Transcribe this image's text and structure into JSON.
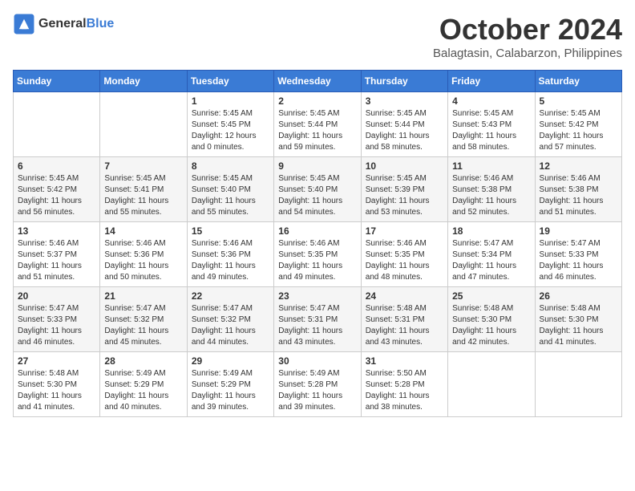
{
  "logo": {
    "general": "General",
    "blue": "Blue"
  },
  "title": "October 2024",
  "location": "Balagtasin, Calabarzon, Philippines",
  "headers": [
    "Sunday",
    "Monday",
    "Tuesday",
    "Wednesday",
    "Thursday",
    "Friday",
    "Saturday"
  ],
  "weeks": [
    [
      {
        "day": "",
        "sunrise": "",
        "sunset": "",
        "daylight": ""
      },
      {
        "day": "",
        "sunrise": "",
        "sunset": "",
        "daylight": ""
      },
      {
        "day": "1",
        "sunrise": "Sunrise: 5:45 AM",
        "sunset": "Sunset: 5:45 PM",
        "daylight": "Daylight: 12 hours and 0 minutes."
      },
      {
        "day": "2",
        "sunrise": "Sunrise: 5:45 AM",
        "sunset": "Sunset: 5:44 PM",
        "daylight": "Daylight: 11 hours and 59 minutes."
      },
      {
        "day": "3",
        "sunrise": "Sunrise: 5:45 AM",
        "sunset": "Sunset: 5:44 PM",
        "daylight": "Daylight: 11 hours and 58 minutes."
      },
      {
        "day": "4",
        "sunrise": "Sunrise: 5:45 AM",
        "sunset": "Sunset: 5:43 PM",
        "daylight": "Daylight: 11 hours and 58 minutes."
      },
      {
        "day": "5",
        "sunrise": "Sunrise: 5:45 AM",
        "sunset": "Sunset: 5:42 PM",
        "daylight": "Daylight: 11 hours and 57 minutes."
      }
    ],
    [
      {
        "day": "6",
        "sunrise": "Sunrise: 5:45 AM",
        "sunset": "Sunset: 5:42 PM",
        "daylight": "Daylight: 11 hours and 56 minutes."
      },
      {
        "day": "7",
        "sunrise": "Sunrise: 5:45 AM",
        "sunset": "Sunset: 5:41 PM",
        "daylight": "Daylight: 11 hours and 55 minutes."
      },
      {
        "day": "8",
        "sunrise": "Sunrise: 5:45 AM",
        "sunset": "Sunset: 5:40 PM",
        "daylight": "Daylight: 11 hours and 55 minutes."
      },
      {
        "day": "9",
        "sunrise": "Sunrise: 5:45 AM",
        "sunset": "Sunset: 5:40 PM",
        "daylight": "Daylight: 11 hours and 54 minutes."
      },
      {
        "day": "10",
        "sunrise": "Sunrise: 5:45 AM",
        "sunset": "Sunset: 5:39 PM",
        "daylight": "Daylight: 11 hours and 53 minutes."
      },
      {
        "day": "11",
        "sunrise": "Sunrise: 5:46 AM",
        "sunset": "Sunset: 5:38 PM",
        "daylight": "Daylight: 11 hours and 52 minutes."
      },
      {
        "day": "12",
        "sunrise": "Sunrise: 5:46 AM",
        "sunset": "Sunset: 5:38 PM",
        "daylight": "Daylight: 11 hours and 51 minutes."
      }
    ],
    [
      {
        "day": "13",
        "sunrise": "Sunrise: 5:46 AM",
        "sunset": "Sunset: 5:37 PM",
        "daylight": "Daylight: 11 hours and 51 minutes."
      },
      {
        "day": "14",
        "sunrise": "Sunrise: 5:46 AM",
        "sunset": "Sunset: 5:36 PM",
        "daylight": "Daylight: 11 hours and 50 minutes."
      },
      {
        "day": "15",
        "sunrise": "Sunrise: 5:46 AM",
        "sunset": "Sunset: 5:36 PM",
        "daylight": "Daylight: 11 hours and 49 minutes."
      },
      {
        "day": "16",
        "sunrise": "Sunrise: 5:46 AM",
        "sunset": "Sunset: 5:35 PM",
        "daylight": "Daylight: 11 hours and 49 minutes."
      },
      {
        "day": "17",
        "sunrise": "Sunrise: 5:46 AM",
        "sunset": "Sunset: 5:35 PM",
        "daylight": "Daylight: 11 hours and 48 minutes."
      },
      {
        "day": "18",
        "sunrise": "Sunrise: 5:47 AM",
        "sunset": "Sunset: 5:34 PM",
        "daylight": "Daylight: 11 hours and 47 minutes."
      },
      {
        "day": "19",
        "sunrise": "Sunrise: 5:47 AM",
        "sunset": "Sunset: 5:33 PM",
        "daylight": "Daylight: 11 hours and 46 minutes."
      }
    ],
    [
      {
        "day": "20",
        "sunrise": "Sunrise: 5:47 AM",
        "sunset": "Sunset: 5:33 PM",
        "daylight": "Daylight: 11 hours and 46 minutes."
      },
      {
        "day": "21",
        "sunrise": "Sunrise: 5:47 AM",
        "sunset": "Sunset: 5:32 PM",
        "daylight": "Daylight: 11 hours and 45 minutes."
      },
      {
        "day": "22",
        "sunrise": "Sunrise: 5:47 AM",
        "sunset": "Sunset: 5:32 PM",
        "daylight": "Daylight: 11 hours and 44 minutes."
      },
      {
        "day": "23",
        "sunrise": "Sunrise: 5:47 AM",
        "sunset": "Sunset: 5:31 PM",
        "daylight": "Daylight: 11 hours and 43 minutes."
      },
      {
        "day": "24",
        "sunrise": "Sunrise: 5:48 AM",
        "sunset": "Sunset: 5:31 PM",
        "daylight": "Daylight: 11 hours and 43 minutes."
      },
      {
        "day": "25",
        "sunrise": "Sunrise: 5:48 AM",
        "sunset": "Sunset: 5:30 PM",
        "daylight": "Daylight: 11 hours and 42 minutes."
      },
      {
        "day": "26",
        "sunrise": "Sunrise: 5:48 AM",
        "sunset": "Sunset: 5:30 PM",
        "daylight": "Daylight: 11 hours and 41 minutes."
      }
    ],
    [
      {
        "day": "27",
        "sunrise": "Sunrise: 5:48 AM",
        "sunset": "Sunset: 5:30 PM",
        "daylight": "Daylight: 11 hours and 41 minutes."
      },
      {
        "day": "28",
        "sunrise": "Sunrise: 5:49 AM",
        "sunset": "Sunset: 5:29 PM",
        "daylight": "Daylight: 11 hours and 40 minutes."
      },
      {
        "day": "29",
        "sunrise": "Sunrise: 5:49 AM",
        "sunset": "Sunset: 5:29 PM",
        "daylight": "Daylight: 11 hours and 39 minutes."
      },
      {
        "day": "30",
        "sunrise": "Sunrise: 5:49 AM",
        "sunset": "Sunset: 5:28 PM",
        "daylight": "Daylight: 11 hours and 39 minutes."
      },
      {
        "day": "31",
        "sunrise": "Sunrise: 5:50 AM",
        "sunset": "Sunset: 5:28 PM",
        "daylight": "Daylight: 11 hours and 38 minutes."
      },
      {
        "day": "",
        "sunrise": "",
        "sunset": "",
        "daylight": ""
      },
      {
        "day": "",
        "sunrise": "",
        "sunset": "",
        "daylight": ""
      }
    ]
  ]
}
